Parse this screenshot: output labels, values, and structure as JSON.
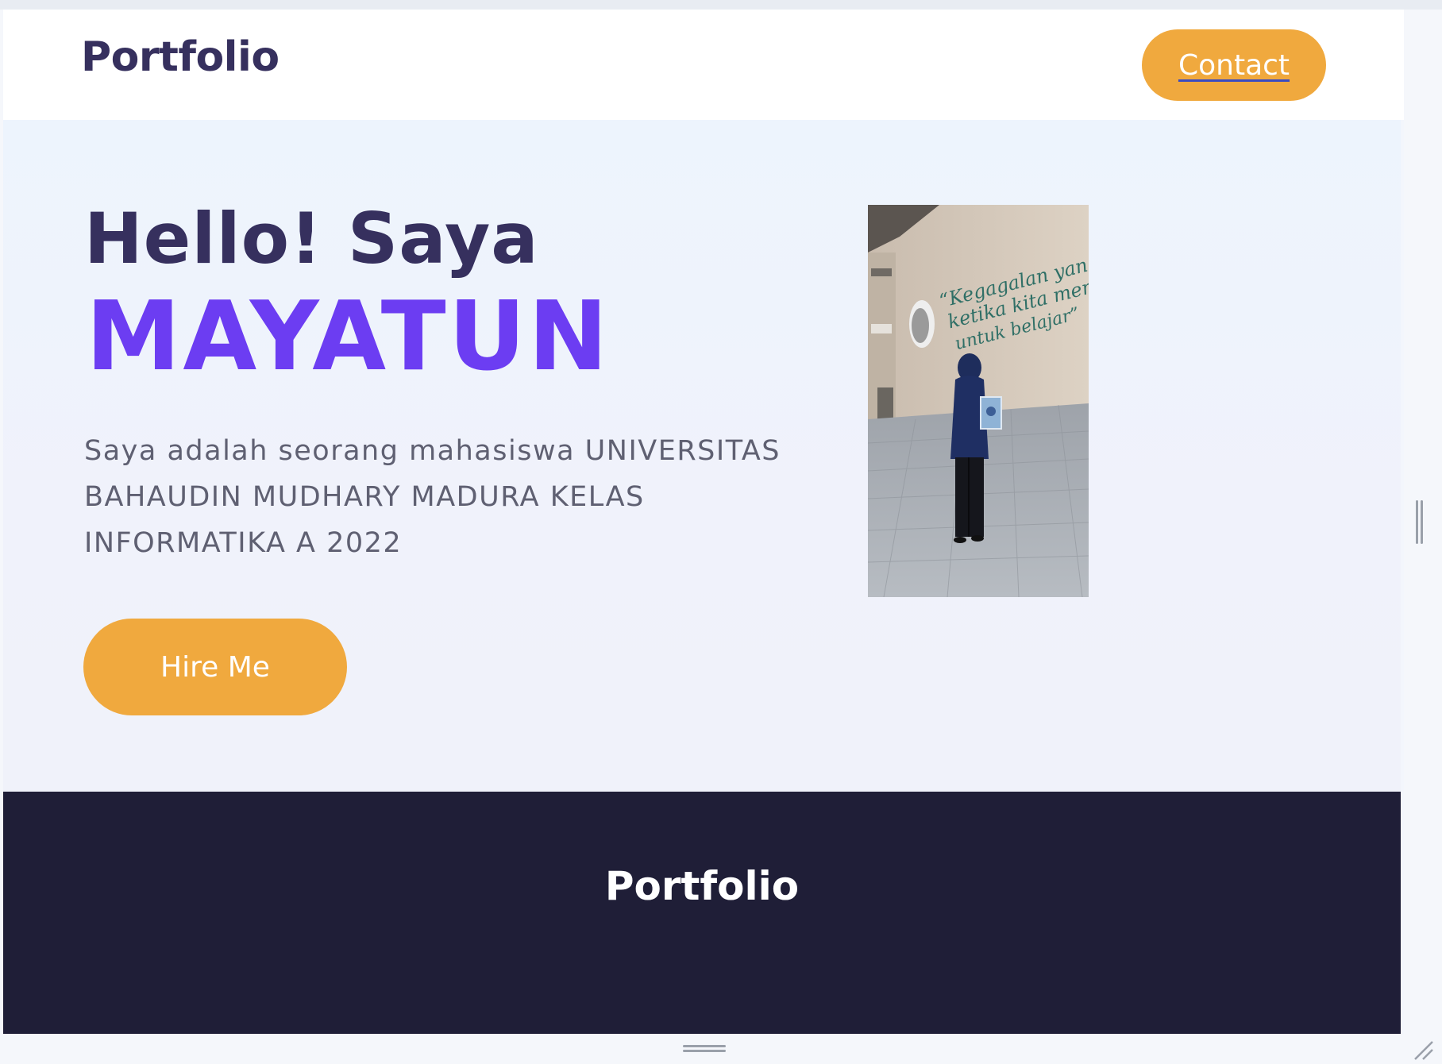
{
  "navbar": {
    "brand": "Portfolio",
    "contact_label": "Contact"
  },
  "hero": {
    "greeting": "Hello! Saya",
    "name": "MAYATUN",
    "description": "Saya adalah seorang mahasiswa UNIVERSITAS BAHAUDIN MUDHARY MADURA KELAS INFORMATIKA A 2022",
    "hire_label": "Hire Me",
    "photo": {
      "wall_text_line1": "“Kegagalan yang s",
      "wall_text_line2": "ketika kita memut",
      "wall_text_line3": "untuk belajar”"
    }
  },
  "section": {
    "title": "Portfolio"
  },
  "colors": {
    "primary_dark": "#36305e",
    "accent_purple": "#6c3df2",
    "button_orange": "#f0a93e",
    "dark_section": "#1f1e37"
  },
  "icons": {
    "vertical_handle": "vertical-resize-handle-icon",
    "horizontal_handle": "horizontal-resize-handle-icon",
    "corner": "resize-corner-icon"
  }
}
